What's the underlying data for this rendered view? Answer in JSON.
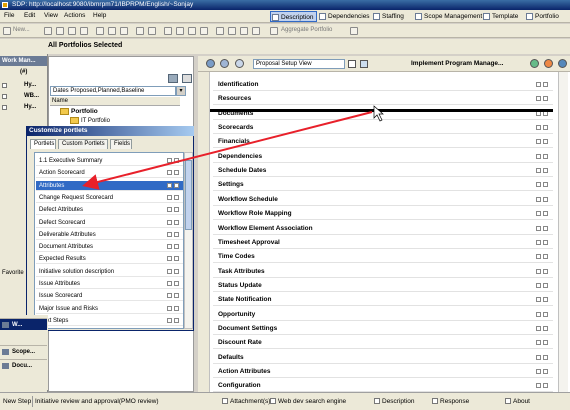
{
  "window": {
    "title": "SDP: http://localhost:9080/ibmrpm71/IBPRPM/English/~Sonjay"
  },
  "menu": [
    "File",
    "Edit",
    "View",
    "Actions",
    "Help"
  ],
  "nav_buttons": [
    "Description",
    "Dependencies",
    "Staffing",
    "Scope Management",
    "Template",
    "Portfolio"
  ],
  "toolbar": {
    "new_label": "New...",
    "aggregate_label": "Aggregate Portfolio"
  },
  "context": {
    "label": "All Portfolios Selected"
  },
  "left": {
    "header": "Work Man...",
    "tree_items": [
      "Hy...",
      "WB...",
      "Hy..."
    ],
    "tree_count": "(#)",
    "favorites_label": "Favorite",
    "bottom_items": [
      "W...",
      "Scope...",
      "Docu..."
    ]
  },
  "middle": {
    "dropdown_value": "Dates Proposed,Planned,Baseline",
    "column_header": "Name",
    "tree": [
      "Portfolio",
      "IT Portfolio"
    ]
  },
  "customize": {
    "title": "Customize portlets",
    "tabs": [
      "Portlets",
      "Custom Portlets",
      "Fields"
    ],
    "items": [
      "1.1 Executive Summary",
      "Action Scorecard",
      "Attributes",
      "Change Request Scorecard",
      "Defect Attributes",
      "Defect Scorecard",
      "Deliverable Attributes",
      "Document Attributes",
      "Expected Results",
      "Initiative solution description",
      "Issue Attributes",
      "Issue Scorecard",
      "Major Issue and Risks",
      "Next Steps"
    ],
    "selected_index": 2
  },
  "right": {
    "view_select": "Proposal  Setup View",
    "title": "Implement Program Manage...",
    "sections": [
      "Identification",
      "Resources",
      "Documents",
      "Scorecards",
      "Financials",
      "Dependencies",
      "Schedule Dates",
      "Settings",
      "Workflow Schedule",
      "Workflow Role Mapping",
      "Workflow Element Association",
      "Timesheet Approval",
      "Time Codes",
      "Task Attributes",
      "Status Update",
      "State Notification",
      "Opportunity",
      "Document Settings",
      "Discount Rate",
      "Defaults",
      "Action Attributes",
      "Configuration"
    ]
  },
  "status": {
    "new_step": "New Step",
    "description": "Initiative review and approval(PMO review)",
    "attachments": "Attachment(s)",
    "web_search": "Web dev search engine",
    "desc_tab": "Description",
    "response": "Response",
    "about": "About"
  },
  "colors": {
    "title_bar": "#0a246a",
    "selection": "#316ac5",
    "arrow": "#e8202a",
    "panel": "#ece9d8"
  }
}
